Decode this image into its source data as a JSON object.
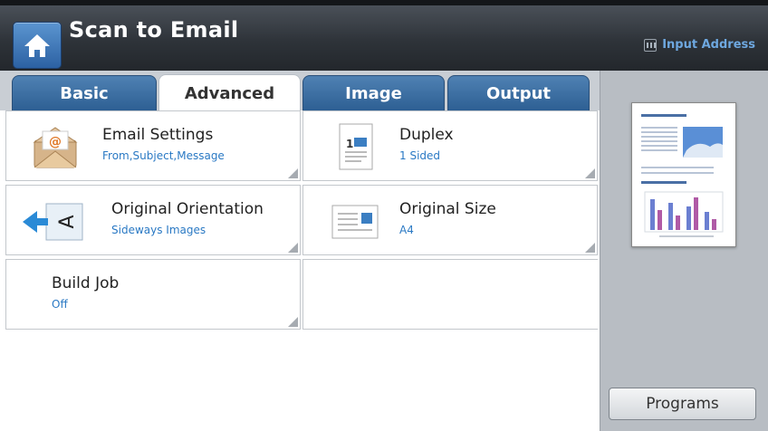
{
  "header": {
    "title": "Scan to Email",
    "input_address_label": "Input Address"
  },
  "tabs": [
    {
      "label": "Basic",
      "active": false
    },
    {
      "label": "Advanced",
      "active": true
    },
    {
      "label": "Image",
      "active": false
    },
    {
      "label": "Output",
      "active": false
    }
  ],
  "settings": [
    {
      "name": "Email Settings",
      "value": "From,Subject,Message",
      "icon": "email-envelope-icon"
    },
    {
      "name": "Duplex",
      "value": "1 Sided",
      "icon": "duplex-page-icon"
    },
    {
      "name": "Original Orientation",
      "value": "Sideways Images",
      "icon": "orientation-icon"
    },
    {
      "name": "Original Size",
      "value": "A4",
      "icon": "original-size-icon"
    },
    {
      "name": "Build Job",
      "value": "Off"
    }
  ],
  "side": {
    "programs_label": "Programs"
  },
  "colors": {
    "accent": "#2a79c4",
    "tab_blue": "#3e70a4",
    "header_dark": "#2e3339"
  }
}
